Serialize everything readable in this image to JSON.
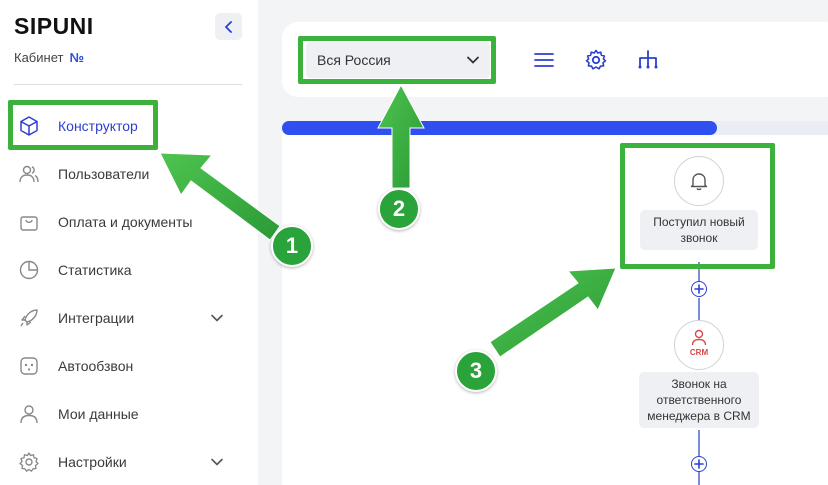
{
  "sidebar": {
    "logo": "SIPUNI",
    "cabinet_label": "Кабинет",
    "cabinet_num": "№",
    "items": [
      {
        "label": "Конструктор",
        "icon": "cube-icon",
        "active": true
      },
      {
        "label": "Пользователи",
        "icon": "users-icon"
      },
      {
        "label": "Оплата и документы",
        "icon": "bag-icon"
      },
      {
        "label": "Статистика",
        "icon": "pie-chart-icon"
      },
      {
        "label": "Интеграции",
        "icon": "rocket-icon",
        "expandable": true
      },
      {
        "label": "Автообзвон",
        "icon": "robot-icon"
      },
      {
        "label": "Мои данные",
        "icon": "user-icon"
      },
      {
        "label": "Настройки",
        "icon": "gear-icon",
        "expandable": true
      }
    ]
  },
  "toolbar": {
    "region_value": "Вся Россия",
    "tools": [
      "menu-icon",
      "gear-icon",
      "tree-icon"
    ]
  },
  "progress": {
    "fraction": 0.777
  },
  "flow": {
    "nodes": [
      {
        "label_line1": "Поступил новый",
        "label_line2": "звонок",
        "icon": "bell-icon"
      },
      {
        "label_line1": "Звонок на",
        "label_line2": "ответственного",
        "label_line3": "менеджера в CRM",
        "icon": "crm-user-icon",
        "icon_text": "CRM"
      }
    ]
  },
  "annotations": {
    "badges": [
      "1",
      "2",
      "3"
    ],
    "color": "#3cb23c"
  },
  "colors": {
    "accent": "#2d3fd0",
    "progress": "#2f4ff0",
    "highlight": "#3cb23c"
  }
}
